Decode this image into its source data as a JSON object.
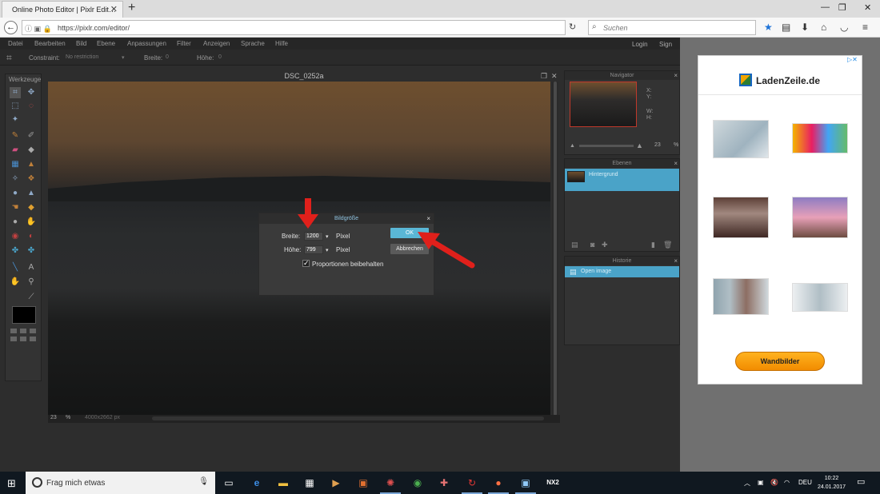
{
  "browser": {
    "tab_title": "Online Photo Editor | Pixlr Edit…",
    "url": "https://pixlr.com/editor/",
    "search_placeholder": "Suchen"
  },
  "editor": {
    "menu": [
      "Datei",
      "Bearbeiten",
      "Bild",
      "Ebene",
      "Anpassungen",
      "Filter",
      "Anzeigen",
      "Sprache",
      "Hilfe"
    ],
    "login": "Login",
    "signup": "Sign up",
    "options": {
      "constraint_label": "Constraint:",
      "constraint_value": "No restriction",
      "width_label": "Breite:",
      "width_value": "0",
      "height_label": "Höhe:",
      "height_value": "0"
    },
    "toolbox_title": "Werkzeuge",
    "canvas": {
      "title": "DSC_0252a",
      "zoom": "23",
      "zoom_unit": "%",
      "size": "4000x2662 px"
    },
    "navigator": {
      "title": "Navigator",
      "x_label": "X:",
      "y_label": "Y:",
      "w_label": "W:",
      "h_label": "H:",
      "zoom": "23",
      "zoom_unit": "%"
    },
    "layers": {
      "title": "Ebenen",
      "items": [
        "Hintergrund"
      ]
    },
    "history": {
      "title": "Historie",
      "items": [
        "Open image"
      ]
    },
    "dialog": {
      "title": "Bildgröße",
      "width_label": "Breite:",
      "width_value": "1200",
      "height_label": "Höhe:",
      "height_value": "799",
      "unit": "Pixel",
      "ok_label": "OK",
      "cancel_label": "Abbrechen",
      "keep_proportions": "Proportionen beibehalten",
      "keep_proportions_checked": true
    }
  },
  "ad": {
    "brand": "LadenZeile.de",
    "button": "Wandbilder"
  },
  "taskbar": {
    "search_placeholder": "Frag mich etwas",
    "language": "DEU",
    "time": "10:22",
    "date": "24.01.2017"
  },
  "colors": {
    "accent": "#5ab7d6",
    "arrow": "#e0201b",
    "ad_button": "#f5a000"
  }
}
